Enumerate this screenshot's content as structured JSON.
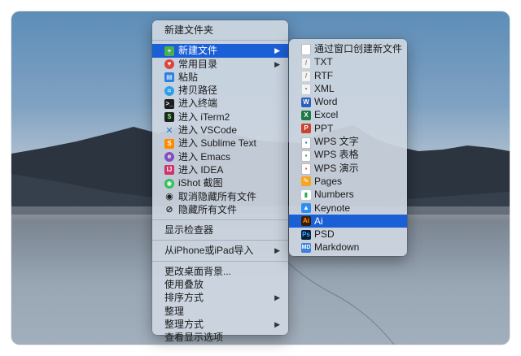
{
  "main_menu": {
    "new_folder": "新建文件夹",
    "new_file": "新建文件",
    "common_dirs": "常用目录",
    "paste": "粘贴",
    "copy_path": "拷贝路径",
    "open_terminal": "进入终端",
    "open_iterm2": "进入 iTerm2",
    "open_vscode": "进入 VSCode",
    "open_sublime": "进入 Sublime Text",
    "open_emacs": "进入 Emacs",
    "open_idea": "进入 IDEA",
    "ishot": "iShot 截图",
    "unhide_all": "取消隐藏所有文件",
    "hide_all": "隐藏所有文件",
    "show_inspector": "显示检查器",
    "import_iphone": "从iPhone或iPad导入",
    "change_bg": "更改桌面背景...",
    "use_stacks": "使用叠放",
    "sort_by": "排序方式",
    "clean_up": "整理",
    "clean_up_by": "整理方式",
    "view_options": "查看显示选项",
    "submenu_arrow": "▶"
  },
  "sub_menu": {
    "from_window": "通过窗口创建新文件",
    "txt": "TXT",
    "rtf": "RTF",
    "xml": "XML",
    "word": "Word",
    "excel": "Excel",
    "ppt": "PPT",
    "wps_doc": "WPS 文字",
    "wps_sheet": "WPS 表格",
    "wps_show": "WPS 演示",
    "pages": "Pages",
    "numbers": "Numbers",
    "keynote": "Keynote",
    "ai": "Ai",
    "psd": "PSD",
    "markdown": "Markdown"
  },
  "icons": {
    "new_file": "new-file-icon",
    "common_dirs": "folder-heart-icon",
    "paste": "clipboard-icon",
    "copy_path": "path-icon",
    "terminal": "terminal-icon",
    "iterm2": "iterm2-icon",
    "vscode": "vscode-icon",
    "sublime": "sublime-icon",
    "emacs": "emacs-icon",
    "idea": "idea-icon",
    "ishot": "ishot-icon",
    "unhide": "eye-icon",
    "hide": "eye-slash-icon"
  },
  "colors": {
    "highlight": "#1a5fd6",
    "menu_bg": "#ced6e1"
  }
}
